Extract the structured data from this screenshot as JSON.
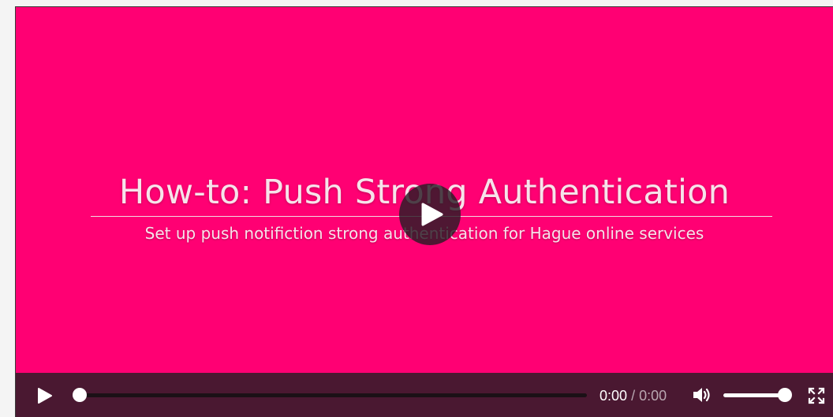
{
  "video": {
    "title": "How-to: Push Strong Authentication",
    "subtitle": "Set up push notifiction strong authentication for Hague online services",
    "background_color": "#ff0073"
  },
  "controls": {
    "play_icon": "play-icon",
    "current_time": "0:00",
    "separator": "/",
    "duration": "0:00",
    "progress_fraction": 0,
    "volume_icon": "volume-icon",
    "volume_fraction": 1,
    "fullscreen_icon": "fullscreen-icon",
    "bar_color": "#4a1831"
  }
}
